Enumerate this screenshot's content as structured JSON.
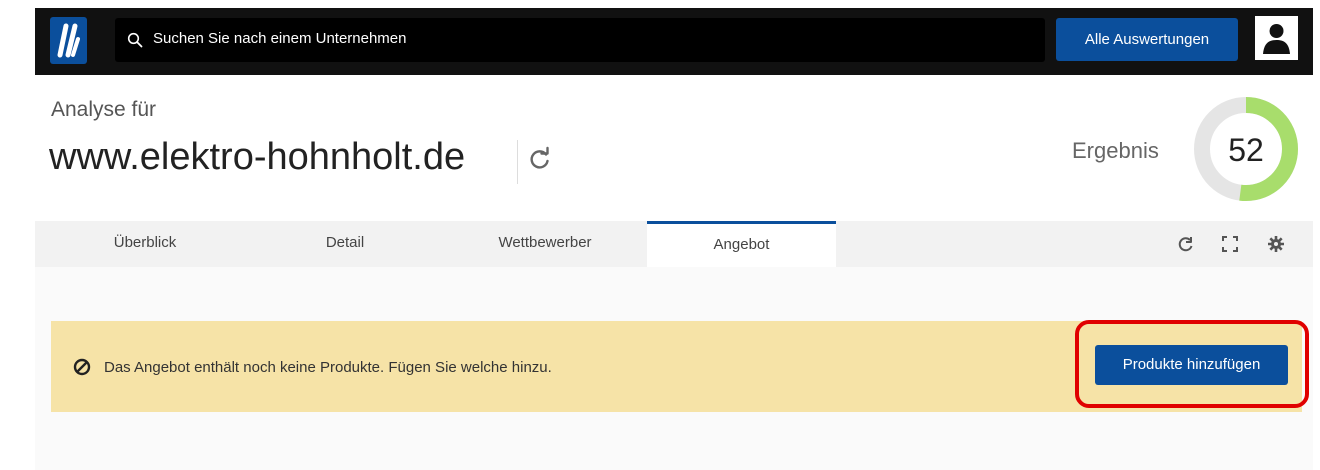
{
  "topbar": {
    "logo_icon": "brand-logo-icon",
    "search_placeholder": "Suchen Sie nach einem Unternehmen",
    "all_reports_label": "Alle Auswertungen",
    "avatar_icon": "user-icon"
  },
  "header": {
    "analyse_label": "Analyse für",
    "domain": "www.elektro-hohnholt.de",
    "refresh_icon": "refresh-icon",
    "score_label": "Ergebnis",
    "score": "52",
    "score_fraction": 0.52
  },
  "tabs": [
    {
      "label": "Überblick",
      "active": false
    },
    {
      "label": "Detail",
      "active": false
    },
    {
      "label": "Wettbewerber",
      "active": false
    },
    {
      "label": "Angebot",
      "active": true
    }
  ],
  "tools": [
    "share-icon",
    "fullscreen-icon",
    "settings-icon"
  ],
  "notice": {
    "icon": "ban-icon",
    "message": "Das Angebot enthält noch keine Produkte. Fügen Sie welche hinzu.",
    "button_label": "Produkte hinzufügen"
  },
  "colors": {
    "accent": "#0b4f9c",
    "notice_bg": "#f6e3a7",
    "gauge_fill": "#a8dd6c",
    "gauge_track": "#e5e5e5",
    "highlight": "#e00000"
  }
}
